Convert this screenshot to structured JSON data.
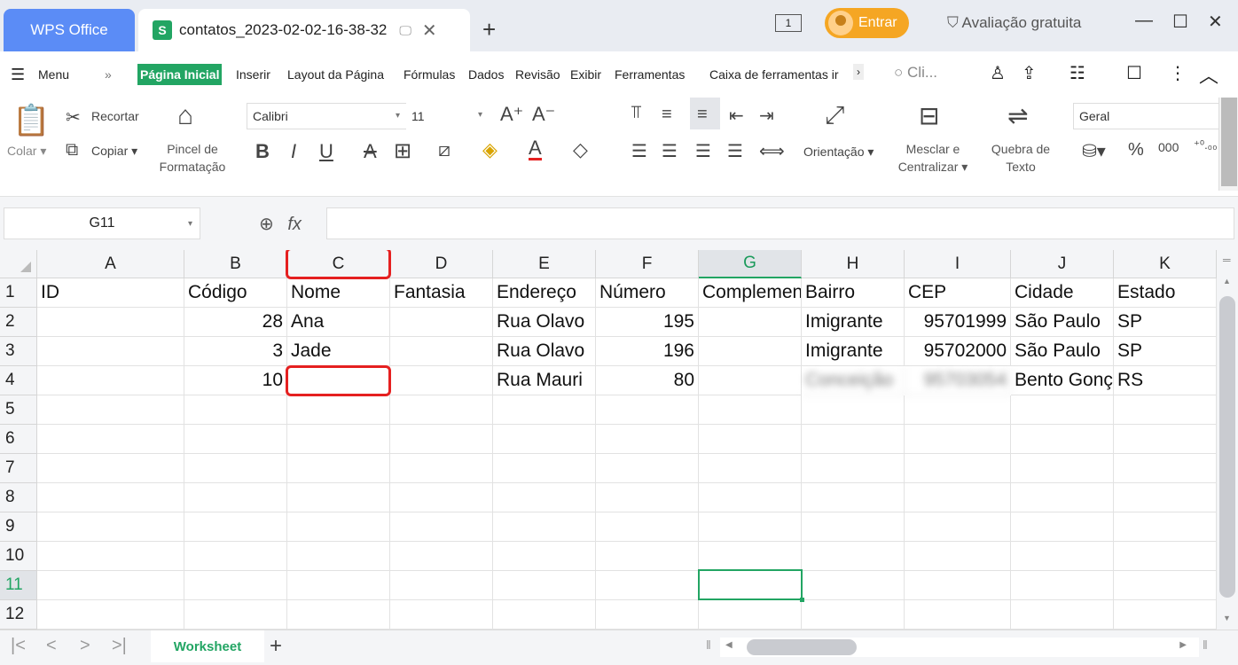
{
  "titlebar": {
    "app_tab": "WPS Office",
    "doc_tab": "contatos_2023-02-02-16-38-32",
    "window_count": "1",
    "login_button": "Entrar",
    "trial_label": "Avaliação gratuita"
  },
  "menu": {
    "menu_label": "Menu",
    "tabs": [
      "Página Inicial",
      "Inserir",
      "Layout da Página",
      "Fórmulas",
      "Dados",
      "Revisão",
      "Exibir",
      "Ferramentas",
      "Caixa de ferramentas ir"
    ],
    "search_placeholder": "Cli..."
  },
  "ribbon": {
    "paste": "Colar",
    "cut": "Recortar",
    "copy": "Copiar",
    "format_painter_line1": "Pincel de",
    "format_painter_line2": "Formatação",
    "font_name": "Calibri",
    "font_size": "11",
    "orientation": "Orientação",
    "merge_line1": "Mesclar e",
    "merge_line2": "Centralizar",
    "wrap_line1": "Quebra de",
    "wrap_line2": "Texto",
    "number_format": "Geral"
  },
  "formula_bar": {
    "cell_ref": "G11",
    "formula": ""
  },
  "grid": {
    "columns": [
      "A",
      "B",
      "C",
      "D",
      "E",
      "F",
      "G",
      "H",
      "I",
      "J",
      "K"
    ],
    "rows": [
      "1",
      "2",
      "3",
      "4",
      "5",
      "6",
      "7",
      "8",
      "9",
      "10",
      "11",
      "12"
    ],
    "data": [
      [
        "ID",
        "Código",
        "Nome",
        "Fantasia",
        "Endereço",
        "Número",
        "Complemento",
        "Bairro",
        "CEP",
        "Cidade",
        "Estado"
      ],
      [
        "",
        "28",
        "Ana",
        "",
        "Rua Olavo",
        "195",
        "",
        "Imigrante",
        "95701999",
        "São Paulo",
        "SP"
      ],
      [
        "",
        "3",
        "Jade",
        "",
        "Rua Olavo",
        "196",
        "",
        "Imigrante",
        "95702000",
        "São Paulo",
        "SP"
      ],
      [
        "",
        "10",
        "",
        "",
        "Rua Mauri",
        "80",
        "",
        "Conceição",
        "95703054",
        "Bento Gonçalves",
        "RS"
      ]
    ]
  },
  "sheets": {
    "active": "Worksheet"
  }
}
